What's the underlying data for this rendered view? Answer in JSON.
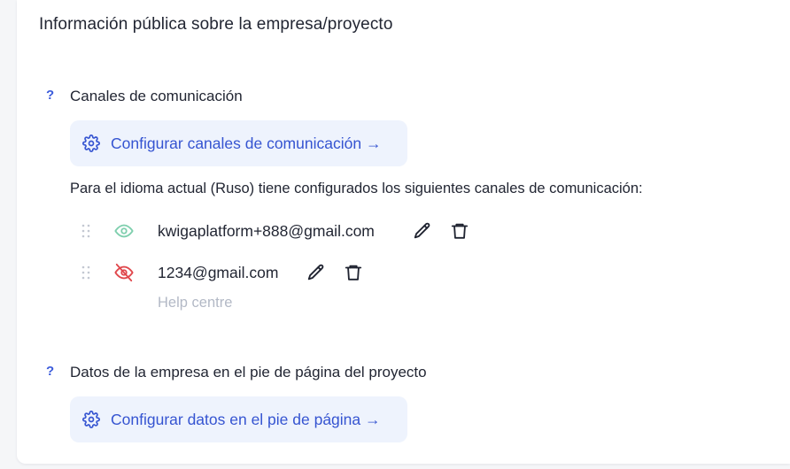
{
  "page": {
    "title": "Información pública sobre la empresa/proyecto"
  },
  "communication": {
    "help": "?",
    "label": "Canales de comunicación",
    "configure_button": "Configurar canales de comunicación →",
    "description": "Para el idioma actual (Ruso) tiene configurados los siguientes canales de comunicación:",
    "channels": [
      {
        "email": "kwigaplatform+888@gmail.com",
        "visible": true,
        "subtitle": ""
      },
      {
        "email": "1234@gmail.com",
        "visible": false,
        "subtitle": "Help centre"
      }
    ]
  },
  "footer": {
    "help": "?",
    "label": "Datos de la empresa en el pie de página del proyecto",
    "configure_button": "Configurar datos en el pie de página →"
  },
  "colors": {
    "accent": "#3554d1",
    "button_bg": "#eef3fd",
    "visible_icon": "#7fcfae",
    "hidden_icon": "#e0474c",
    "muted_text": "#b3b9c6"
  },
  "icons": {
    "gear": "gear-icon",
    "drag": "drag-handle-icon",
    "visible": "eye-icon",
    "hidden": "eye-off-icon",
    "edit": "pencil-icon",
    "delete": "trash-icon"
  }
}
